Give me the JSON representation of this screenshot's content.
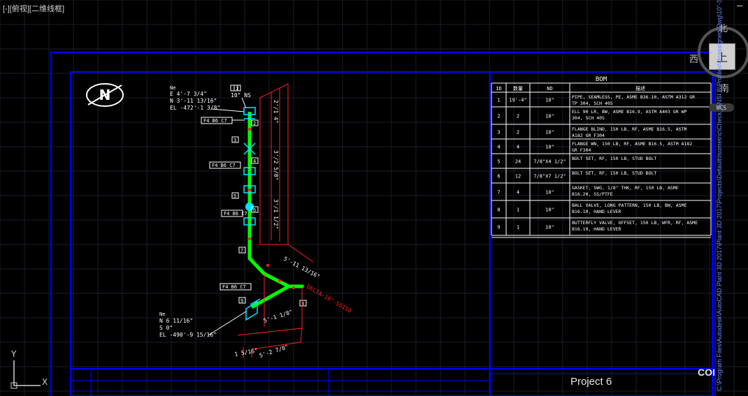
{
  "viewport": {
    "label": "[-][俯视][二维线框]",
    "compass": {
      "north": "北",
      "west": "西",
      "south": "南",
      "face": "上",
      "wcs": "WCS"
    },
    "ucs": {
      "x": "X",
      "y": "Y"
    }
  },
  "drawing": {
    "north_symbol": "N",
    "coord_top": [
      "E 4'-7 3/4\"",
      "N 3'-11 13/16\"",
      "EL -472'-1 3/8\""
    ],
    "coord_top_label": "Ne",
    "coord_bottom": [
      "N 6 11/16\"",
      "S 0\"",
      "EL -490'-9 15/16\""
    ],
    "coord_bottom_label": "Ne",
    "size_label": "10\" NS",
    "dims": [
      "5'-11 13/16\"",
      "5'-1 1/8\"",
      "5'-2 7/8\"",
      "1 5/16\"",
      "3'/2 5/8\"",
      "3'/1 1/2\"",
      "2'/1 4\""
    ],
    "slope_label": "DELTA-10\"-SS150",
    "tags": [
      "F4 B6 C7",
      "F4 B6 C7",
      "F4 B6 C7",
      "F4 B6 C7"
    ],
    "item_labels": [
      "1",
      "2",
      "3",
      "4",
      "5",
      "6",
      "7",
      "8",
      "9"
    ]
  },
  "bom": {
    "title": "BOM",
    "headers": [
      "ID",
      "数量",
      "ND",
      "描述"
    ],
    "rows": [
      [
        "1",
        "19'-4\"",
        "10\"",
        "PIPE, SEAMLESS, PE, ASME B36.10, ASTM A312 GR TP 304, SCH 40S"
      ],
      [
        "2",
        "2",
        "10\"",
        "ELL 90 LR, BW, ASME B16.9, ASTM A403 GR WP 304, SCH 40S"
      ],
      [
        "3",
        "2",
        "10\"",
        "FLANGE BLIND, 150 LB, RF, ASME B16.5, ASTM A182 GR F304"
      ],
      [
        "4",
        "4",
        "10\"",
        "FLANGE WN, 150 LB, RF, ASME B16.5, ASTM A182 GR F304"
      ],
      [
        "5",
        "24",
        "7/8\"X4 1/2\"",
        "BOLT SET, RF, 150 LB, STUD BOLT"
      ],
      [
        "6",
        "12",
        "7/8\"X7 1/2\"",
        "BOLT SET, RF, 150 LB, STUD BOLT"
      ],
      [
        "7",
        "4",
        "10\"",
        "GASKET, SWG, 1/8\" THK, RF, 150 LB, ASME B16.20, SS/PTFE"
      ],
      [
        "8",
        "1",
        "10\"",
        "BALL VALVE, LONG PATTERN, 150 LB, BW, ASME B16.10, HAND LEVER"
      ],
      [
        "9",
        "1",
        "10\"",
        "BUTTERFLY VALVE, OFFSET, 150 LB, WFR, RF, ASME B16.10, HAND LEVER"
      ]
    ]
  },
  "titleblock": {
    "project": "Project 6",
    "corner": "COI",
    "path": "C:\\Program Files\\Autodesk\\AutoCAD Plant 3D 2017\\Plant 3D 2017\\Projects\\Default\\Isometric\\Check_ANSI B\\Profiles\\Unassigned\\Dwg\\10\"-SS150-001"
  },
  "colors": {
    "frame": "#0000ff",
    "pipe": "#00ff00",
    "dim": "#ff2020",
    "text": "#ffffff",
    "symbol": "#00e5ff",
    "grid": "#1a1a2a"
  }
}
